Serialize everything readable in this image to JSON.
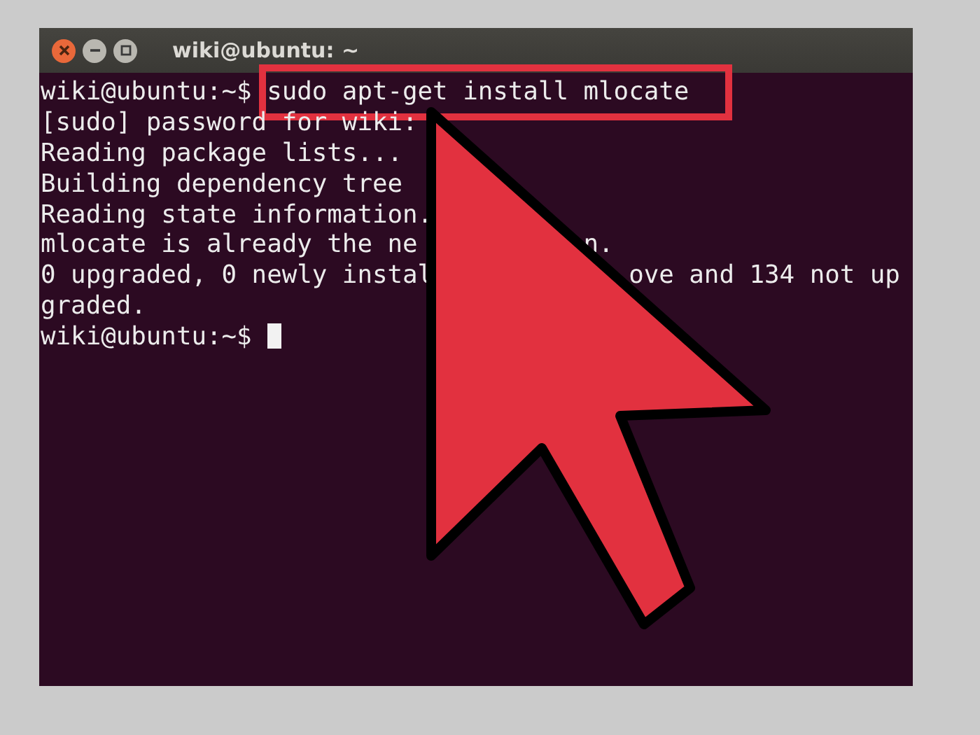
{
  "window": {
    "title": "wiki@ubuntu: ~"
  },
  "terminal": {
    "lines": [
      {
        "kind": "command",
        "prompt": "wiki@ubuntu:~$",
        "command": "sudo apt-get install mlocate",
        "highlighted": true
      },
      {
        "kind": "output",
        "fragments": [
          "[sudo] password for wiki:"
        ]
      },
      {
        "kind": "output",
        "fragments": [
          "Reading package lists..."
        ]
      },
      {
        "kind": "output",
        "fragments": [
          "Building dependency tree"
        ]
      },
      {
        "kind": "output",
        "fragments": [
          "Reading state information."
        ]
      },
      {
        "kind": "output",
        "fragments": [
          "mlocate is already the ne",
          "n."
        ]
      },
      {
        "kind": "output",
        "fragments": [
          "0 upgraded, 0 newly instal",
          "ove and 134 not up"
        ]
      },
      {
        "kind": "output",
        "fragments": [
          "graded."
        ]
      },
      {
        "kind": "prompt",
        "prompt": "wiki@ubuntu:~$",
        "cursor": true
      }
    ]
  }
}
